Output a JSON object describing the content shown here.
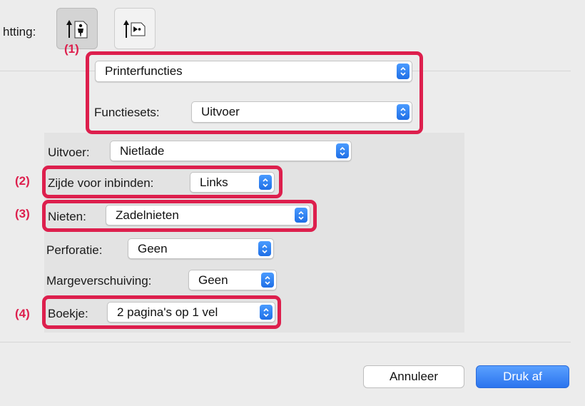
{
  "orientation": {
    "label": "htting:",
    "options": [
      "portrait-icon",
      "landscape-icon"
    ],
    "selected": "portrait-icon"
  },
  "top_section": {
    "section_popup": "Printerfuncties",
    "feature_sets_label": "Functiesets:",
    "feature_sets_value": "Uitvoer"
  },
  "output": {
    "output_label": "Uitvoer:",
    "output_value": "Nietlade",
    "binding_label": "Zijde voor inbinden:",
    "binding_value": "Links",
    "staple_label": "Nieten:",
    "staple_value": "Zadelnieten",
    "punch_label": "Perforatie:",
    "punch_value": "Geen",
    "margin_label": "Margeverschuiving:",
    "margin_value": "Geen",
    "booklet_label": "Boekje:",
    "booklet_value": "2 pagina's op 1 vel"
  },
  "callouts": [
    "(1)",
    "(2)",
    "(3)",
    "(4)"
  ],
  "buttons": {
    "cancel": "Annuleer",
    "print": "Druk af"
  },
  "colors": {
    "highlight": "#dd1f4d",
    "accent": "#2f7cf6"
  }
}
